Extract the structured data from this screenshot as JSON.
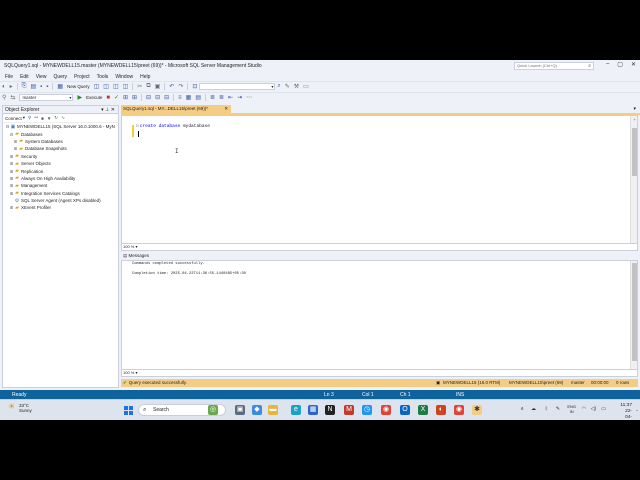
{
  "window": {
    "title": "SQLQuery1.sql - MYNEWDELL15.master (MYNEWDELL15\\preet (69))* - Microsoft SQL Server Management Studio",
    "quick_launch": "Quick Launch (Ctrl+Q)"
  },
  "menu": [
    "File",
    "Edit",
    "View",
    "Query",
    "Project",
    "Tools",
    "Window",
    "Help"
  ],
  "toolbar": {
    "new_query": "New Query",
    "database": "master",
    "execute": "Execute"
  },
  "object_explorer": {
    "title": "Object Explorer",
    "connect": "Connect",
    "tree": [
      {
        "label": "MYNEWDELL15 (SQL Server 16.0.1000.6 - MyN",
        "level": 0,
        "expander": "⊟",
        "icon": "server-icon"
      },
      {
        "label": "Databases",
        "level": 1,
        "expander": "⊟",
        "icon": "folder-icon"
      },
      {
        "label": "System Databases",
        "level": 2,
        "expander": "⊞",
        "icon": "folder-icon"
      },
      {
        "label": "Database Snapshots",
        "level": 2,
        "expander": "⊞",
        "icon": "folder-icon"
      },
      {
        "label": "Security",
        "level": 1,
        "expander": "⊞",
        "icon": "folder-icon"
      },
      {
        "label": "Server Objects",
        "level": 1,
        "expander": "⊞",
        "icon": "folder-icon"
      },
      {
        "label": "Replication",
        "level": 1,
        "expander": "⊞",
        "icon": "folder-icon"
      },
      {
        "label": "Always On High Availability",
        "level": 1,
        "expander": "⊞",
        "icon": "folder-icon"
      },
      {
        "label": "Management",
        "level": 1,
        "expander": "⊞",
        "icon": "folder-icon"
      },
      {
        "label": "Integration Services Catalogs",
        "level": 1,
        "expander": "⊞",
        "icon": "folder-icon"
      },
      {
        "label": "SQL Server Agent (Agent XPs disabled)",
        "level": 1,
        "expander": "",
        "icon": "agent-icon"
      },
      {
        "label": "XEvent Profiler",
        "level": 1,
        "expander": "⊞",
        "icon": "folder-icon"
      }
    ]
  },
  "editor": {
    "tab_label": "SQLQuery1.sql - MY...DELL15\\preet (69))*",
    "code_keyword1": "create",
    "code_keyword2": "database",
    "code_name": "mydatabase",
    "zoom": "100 %"
  },
  "messages": {
    "tab_label": "Messages",
    "line1": "Commands completed successfully.",
    "line2": "Completion time: 2025-04-22T11:36:55.1440485+05:30",
    "zoom": "100 %"
  },
  "query_status": {
    "message": "Query executed successfully.",
    "server": "MYNEWDELL15 (16.0 RTM)",
    "user": "MYNEWDELL15\\preet (69)",
    "database": "master",
    "elapsed": "00:00:00",
    "rows": "0 rows"
  },
  "status_bar": {
    "state": "Ready",
    "line": "Ln 3",
    "col": "Col 1",
    "ch": "Ch 1",
    "mode": "INS"
  },
  "taskbar": {
    "temperature": "33°C",
    "weather": "Sunny",
    "search": "Search",
    "language_line1": "ENG",
    "language_line2": "IN",
    "time": "11:37",
    "date": "22-04-2025"
  },
  "colors": {
    "accent": "#0e639c",
    "tab_highlight": "#f5cc84",
    "keyword": "#0000ff"
  }
}
